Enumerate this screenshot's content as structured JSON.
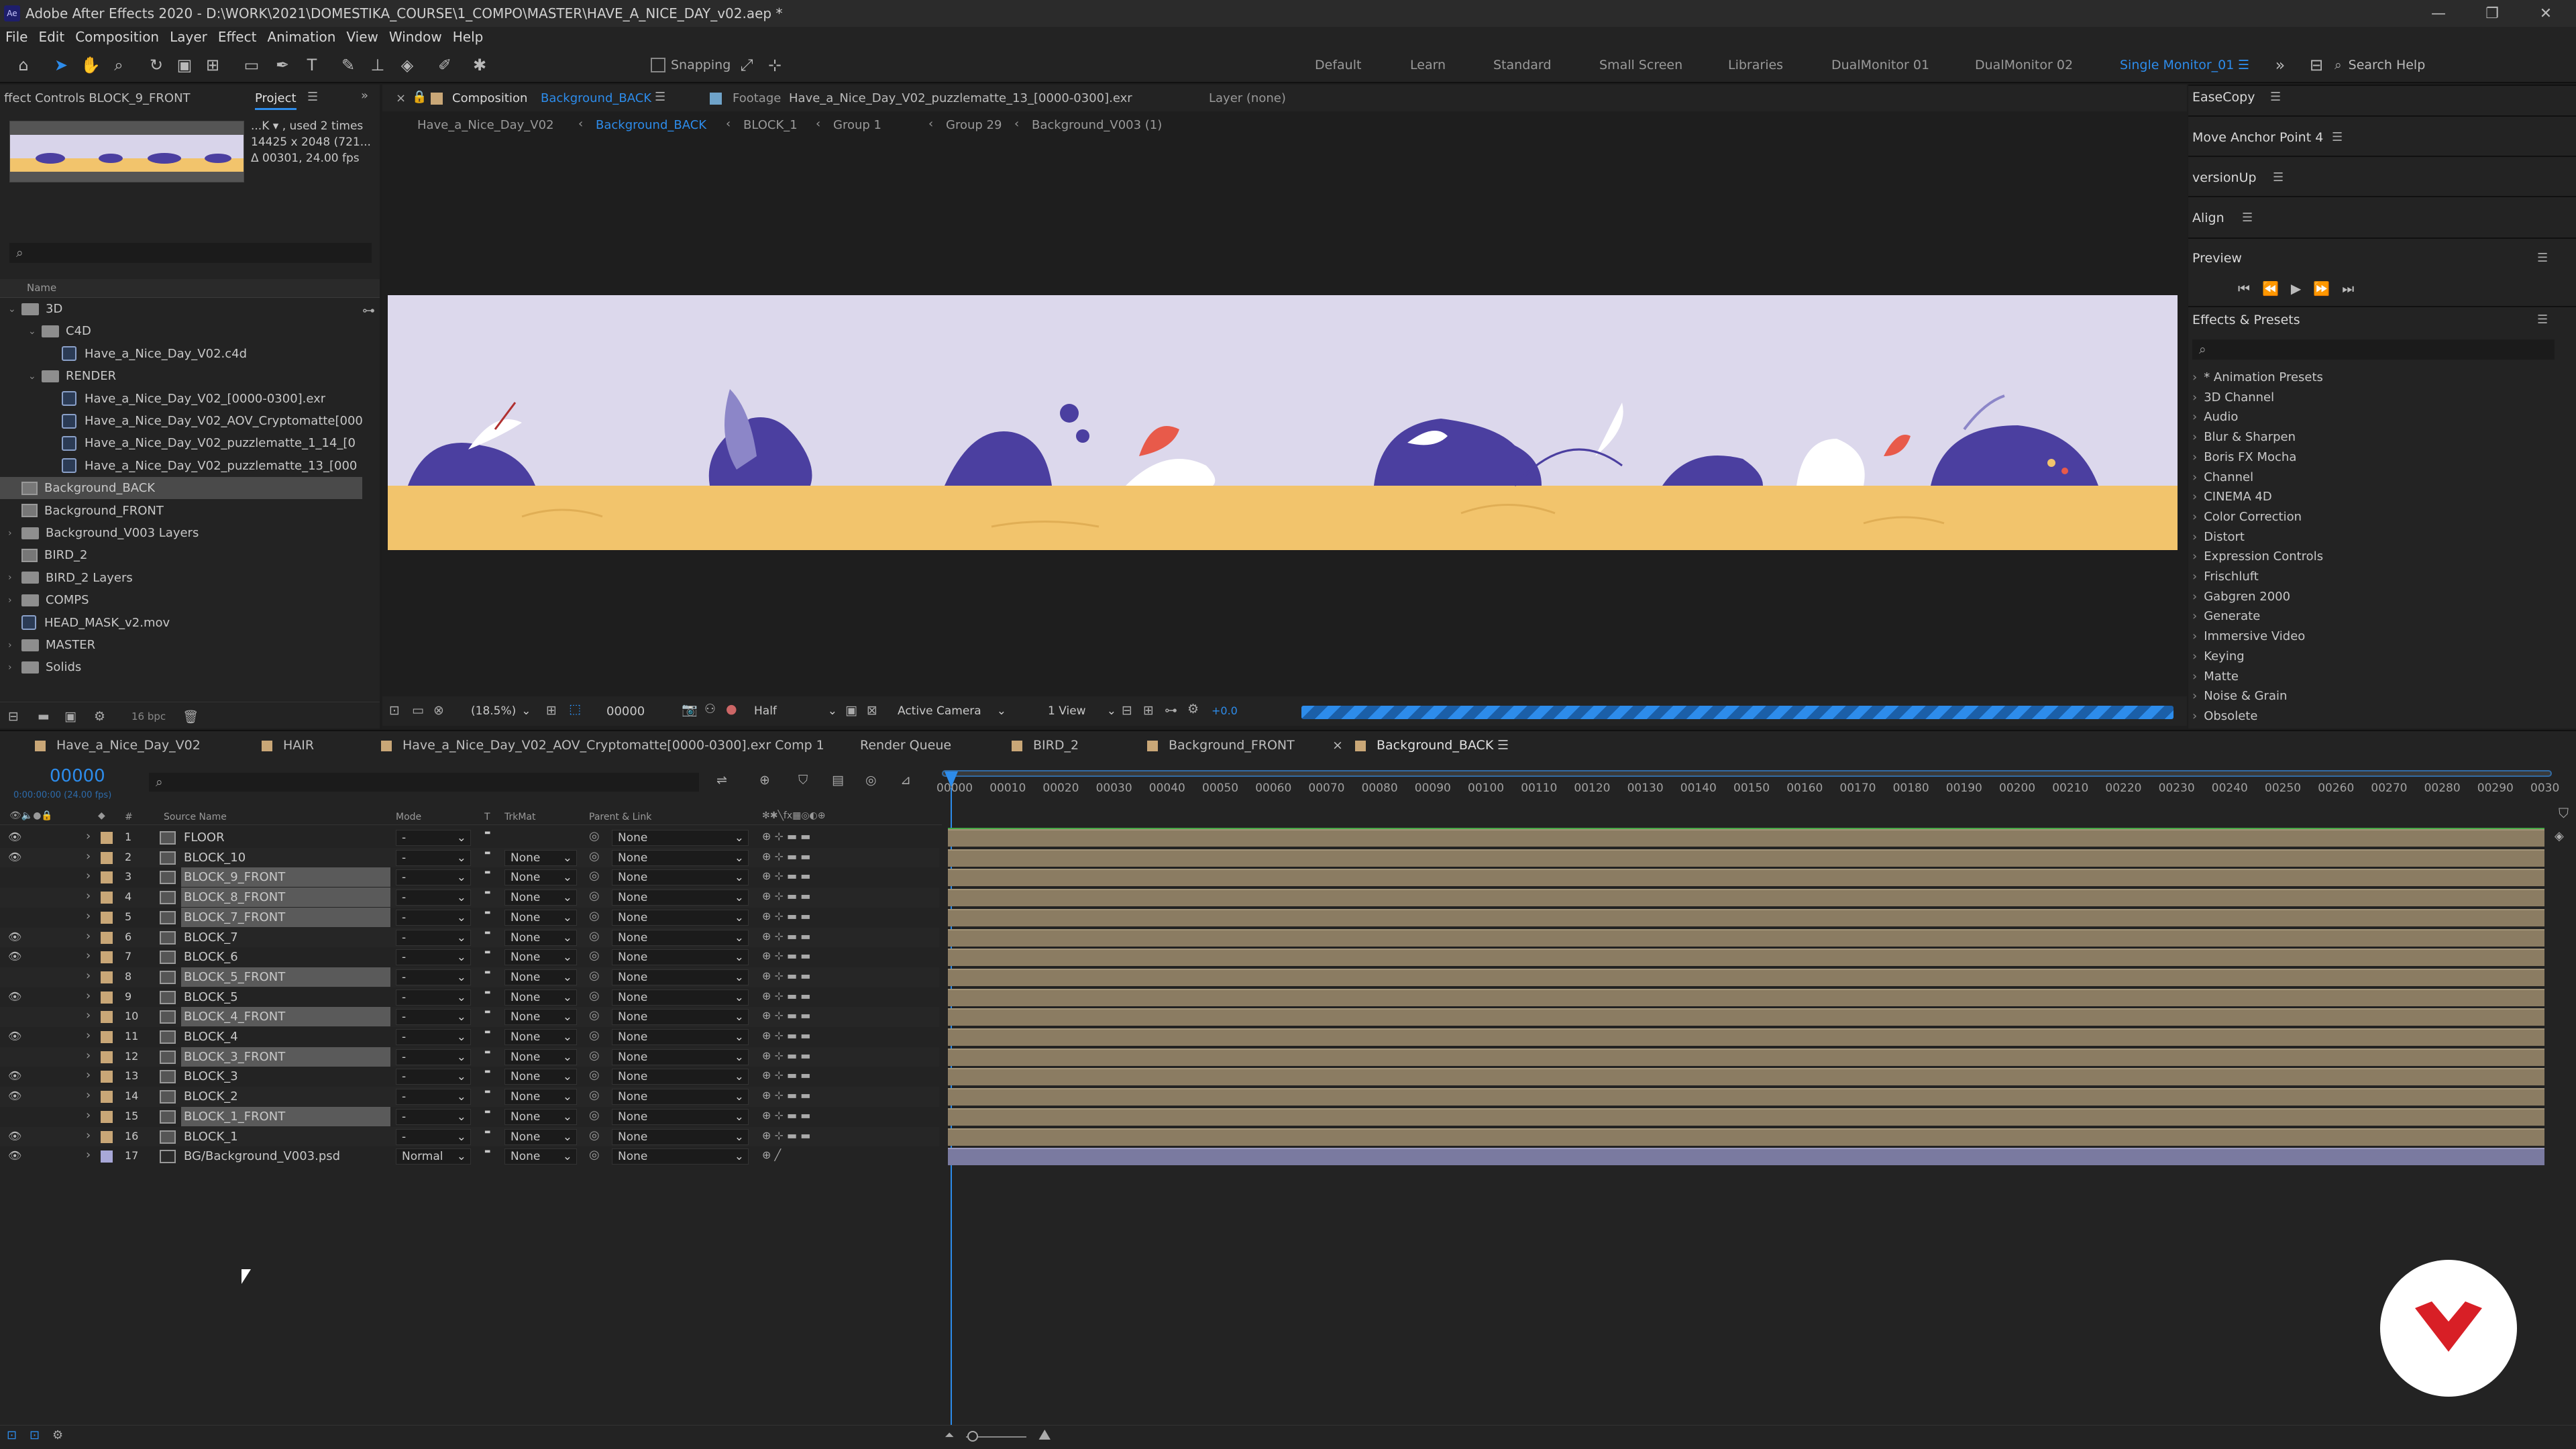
{
  "titlebar": {
    "title": "Adobe After Effects 2020 - D:\\WORK\\2021\\DOMESTIKA_COURSE\\1_COMPO\\MASTER\\HAVE_A_NICE_DAY_v02.aep *",
    "logo": "Ae"
  },
  "menu": [
    "File",
    "Edit",
    "Composition",
    "Layer",
    "Effect",
    "Animation",
    "View",
    "Window",
    "Help"
  ],
  "toolbar": {
    "snapping": "Snapping",
    "search": "Search Help",
    "workspaces": [
      "Default",
      "Learn",
      "Standard",
      "Small Screen",
      "Libraries",
      "DualMonitor 01",
      "DualMonitor 02",
      "Single Monitor_01"
    ]
  },
  "project": {
    "tab_effect_controls": "ffect Controls BLOCK_9_FRONT",
    "tab_project": "Project",
    "info1": "...K  ▾ , used 2 times",
    "info2": "14425 x 2048  (721...",
    "info3": "Δ 00301, 24.00 fps",
    "col_name": "Name",
    "bpc": "16 bpc",
    "items": [
      {
        "label": "3D",
        "level": 0,
        "type": "folder"
      },
      {
        "label": "C4D",
        "level": 1,
        "type": "folder"
      },
      {
        "label": "Have_a_Nice_Day_V02.c4d",
        "level": 2,
        "type": "file"
      },
      {
        "label": "RENDER",
        "level": 1,
        "type": "folder"
      },
      {
        "label": "Have_a_Nice_Day_V02_[0000-0300].exr",
        "level": 2,
        "type": "file"
      },
      {
        "label": "Have_a_Nice_Day_V02_AOV_Cryptomatte[000",
        "level": 2,
        "type": "file"
      },
      {
        "label": "Have_a_Nice_Day_V02_puzzlematte_1_14_[0",
        "level": 2,
        "type": "file"
      },
      {
        "label": "Have_a_Nice_Day_V02_puzzlematte_13_[000",
        "level": 2,
        "type": "file"
      },
      {
        "label": "Background_BACK",
        "level": 0,
        "type": "comp",
        "selected": true
      },
      {
        "label": "Background_FRONT",
        "level": 0,
        "type": "comp"
      },
      {
        "label": "Background_V003 Layers",
        "level": 0,
        "type": "folder"
      },
      {
        "label": "BIRD_2",
        "level": 0,
        "type": "comp"
      },
      {
        "label": "BIRD_2 Layers",
        "level": 0,
        "type": "folder"
      },
      {
        "label": "COMPS",
        "level": 0,
        "type": "folder"
      },
      {
        "label": "HEAD_MASK_v2.mov",
        "level": 0,
        "type": "file"
      },
      {
        "label": "MASTER",
        "level": 0,
        "type": "folder"
      },
      {
        "label": "Solids",
        "level": 0,
        "type": "folder"
      }
    ]
  },
  "viewer": {
    "tab_comp": "Composition",
    "tab_comp_name": "Background_BACK",
    "tab_footage": "Footage",
    "tab_footage_name": "Have_a_Nice_Day_V02_puzzlematte_13_[0000-0300].exr",
    "tab_layer": "Layer  (none)",
    "breadcrumbs": [
      "Have_a_Nice_Day_V02",
      "Background_BACK",
      "BLOCK_1",
      "Group 1",
      "Group 29",
      "Background_V003 (1)"
    ],
    "zoom": "(18.5%)",
    "time": "00000",
    "resolution": "Half",
    "camera": "Active Camera",
    "views": "1 View",
    "exposure": "+0.0"
  },
  "right": {
    "easecopy": "EaseCopy",
    "move_anchor": "Move Anchor Point 4",
    "versionup": "versionUp",
    "align": "Align",
    "preview": "Preview",
    "effects_presets": "Effects & Presets",
    "effects": [
      "* Animation Presets",
      "3D Channel",
      "Audio",
      "Blur & Sharpen",
      "Boris FX Mocha",
      "Channel",
      "CINEMA 4D",
      "Color Correction",
      "Distort",
      "Expression Controls",
      "Frischluft",
      "Gabgren 2000",
      "Generate",
      "Immersive Video",
      "Keying",
      "Matte",
      "Noise & Grain",
      "Obsolete"
    ]
  },
  "timeline": {
    "tabs": [
      "Have_a_Nice_Day_V02",
      "HAIR",
      "Have_a_Nice_Day_V02_AOV_Cryptomatte[0000-0300].exr Comp 1",
      "Render Queue",
      "BIRD_2",
      "Background_FRONT",
      "Background_BACK"
    ],
    "timecode": "00000",
    "timecode_sub": "0:00:00:00 (24.00 fps)",
    "headers": {
      "num": "#",
      "source": "Source Name",
      "mode": "Mode",
      "t": "T",
      "trkmat": "TrkMat",
      "parent": "Parent & Link"
    },
    "ruler": [
      "00000",
      "00010",
      "00020",
      "00030",
      "00040",
      "00050",
      "00060",
      "00070",
      "00080",
      "00090",
      "00100",
      "00110",
      "00120",
      "00130",
      "00140",
      "00150",
      "00160",
      "00170",
      "00180",
      "00190",
      "00200",
      "00210",
      "00220",
      "00230",
      "00240",
      "00250",
      "00260",
      "00270",
      "00280",
      "00290",
      "0030"
    ],
    "layers": [
      {
        "n": "1",
        "name": "FLOOR",
        "mode": "-",
        "trk": "",
        "parent": "None",
        "eye": true,
        "sel": false
      },
      {
        "n": "2",
        "name": "BLOCK_10",
        "mode": "-",
        "trk": "None",
        "parent": "None",
        "eye": true,
        "sel": false
      },
      {
        "n": "3",
        "name": "BLOCK_9_FRONT",
        "mode": "-",
        "trk": "None",
        "parent": "None",
        "eye": false,
        "sel": true
      },
      {
        "n": "4",
        "name": "BLOCK_8_FRONT",
        "mode": "-",
        "trk": "None",
        "parent": "None",
        "eye": false,
        "sel": true
      },
      {
        "n": "5",
        "name": "BLOCK_7_FRONT",
        "mode": "-",
        "trk": "None",
        "parent": "None",
        "eye": false,
        "sel": true
      },
      {
        "n": "6",
        "name": "BLOCK_7",
        "mode": "-",
        "trk": "None",
        "parent": "None",
        "eye": true,
        "sel": false
      },
      {
        "n": "7",
        "name": "BLOCK_6",
        "mode": "-",
        "trk": "None",
        "parent": "None",
        "eye": true,
        "sel": false
      },
      {
        "n": "8",
        "name": "BLOCK_5_FRONT",
        "mode": "-",
        "trk": "None",
        "parent": "None",
        "eye": false,
        "sel": true
      },
      {
        "n": "9",
        "name": "BLOCK_5",
        "mode": "-",
        "trk": "None",
        "parent": "None",
        "eye": true,
        "sel": false
      },
      {
        "n": "10",
        "name": "BLOCK_4_FRONT",
        "mode": "-",
        "trk": "None",
        "parent": "None",
        "eye": false,
        "sel": true
      },
      {
        "n": "11",
        "name": "BLOCK_4",
        "mode": "-",
        "trk": "None",
        "parent": "None",
        "eye": true,
        "sel": false
      },
      {
        "n": "12",
        "name": "BLOCK_3_FRONT",
        "mode": "-",
        "trk": "None",
        "parent": "None",
        "eye": false,
        "sel": true
      },
      {
        "n": "13",
        "name": "BLOCK_3",
        "mode": "-",
        "trk": "None",
        "parent": "None",
        "eye": true,
        "sel": false
      },
      {
        "n": "14",
        "name": "BLOCK_2",
        "mode": "-",
        "trk": "None",
        "parent": "None",
        "eye": true,
        "sel": false
      },
      {
        "n": "15",
        "name": "BLOCK_1_FRONT",
        "mode": "-",
        "trk": "None",
        "parent": "None",
        "eye": false,
        "sel": true
      },
      {
        "n": "16",
        "name": "BLOCK_1",
        "mode": "-",
        "trk": "None",
        "parent": "None",
        "eye": true,
        "sel": false
      },
      {
        "n": "17",
        "name": "BG/Background_V003.psd",
        "mode": "Normal",
        "trk": "None",
        "parent": "None",
        "eye": true,
        "sel": false
      }
    ]
  },
  "colors": {
    "accent": "#2d8ceb",
    "bar": "#8b7c62",
    "sky": "#d8d4ea",
    "floor": "#f2c46c",
    "plant": "#4b3fa0"
  }
}
